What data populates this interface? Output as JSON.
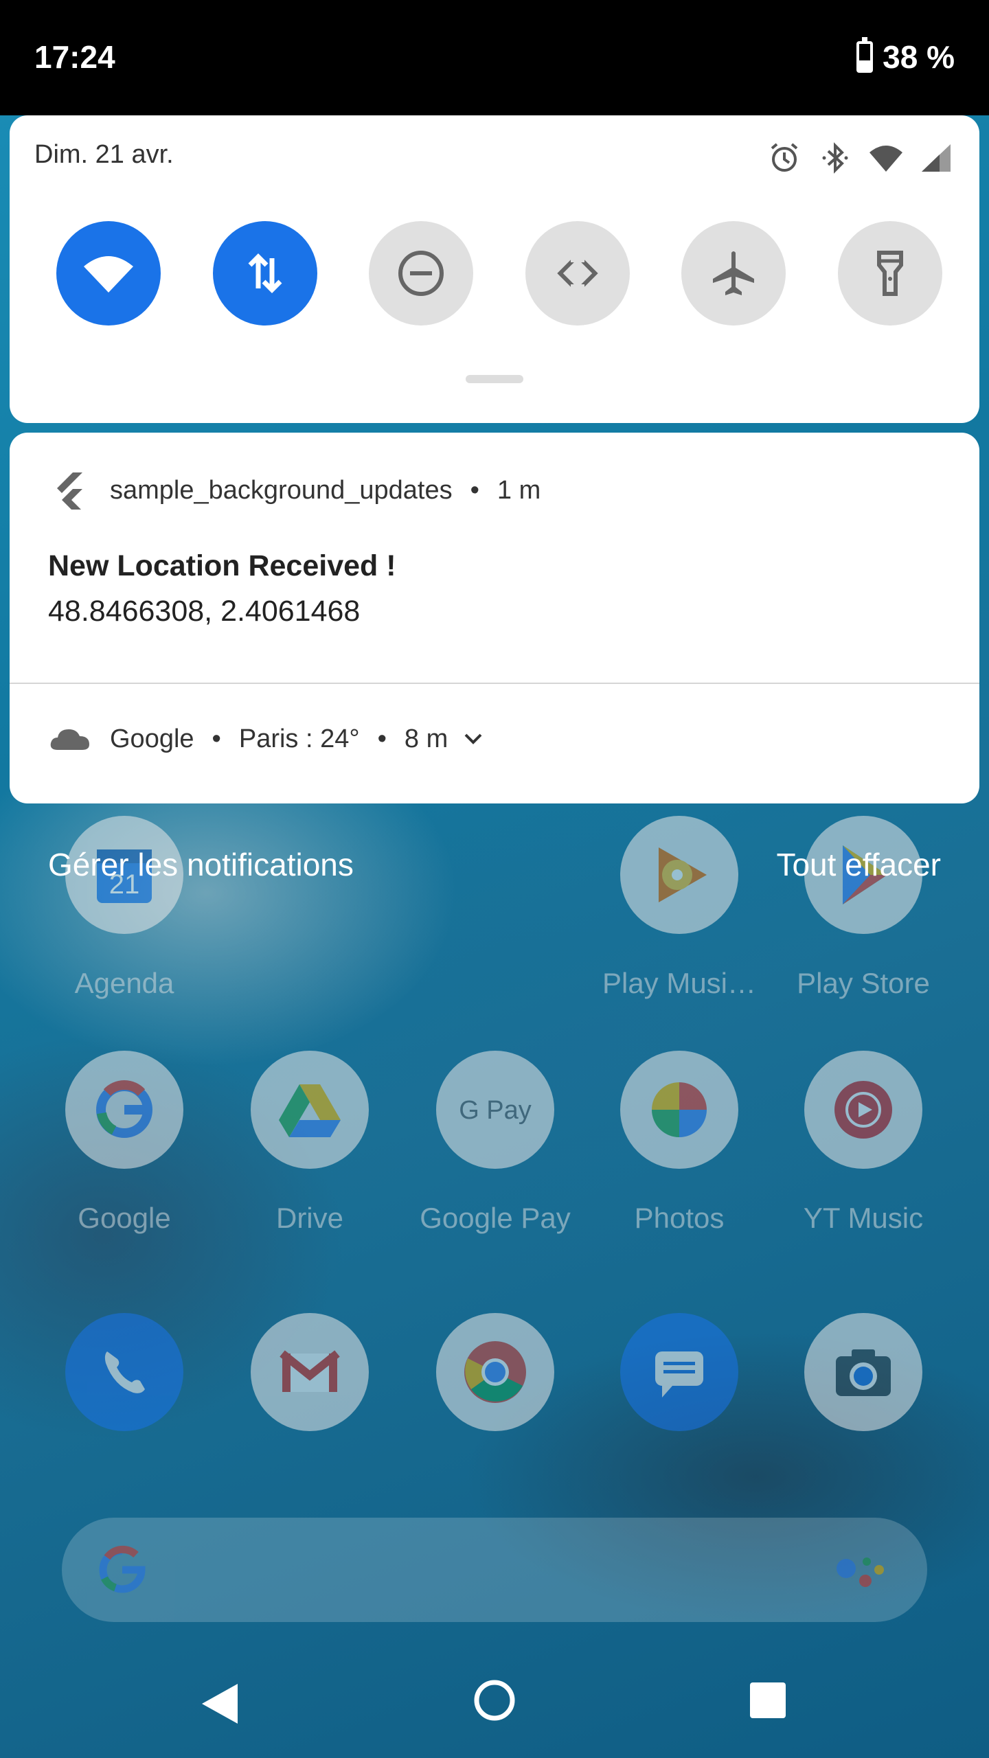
{
  "status_bar": {
    "time": "17:24",
    "battery": "38 %"
  },
  "quick_settings": {
    "date": "Dim. 21 avr.",
    "status_icons": [
      "alarm-icon",
      "bluetooth-icon",
      "wifi-icon",
      "cell-signal-icon"
    ],
    "tiles": [
      {
        "name": "wifi",
        "active": true,
        "icon": "wifi-icon"
      },
      {
        "name": "mobile-data",
        "active": true,
        "icon": "data-arrows-icon"
      },
      {
        "name": "do-not-disturb",
        "active": false,
        "icon": "do-not-disturb-icon"
      },
      {
        "name": "auto-rotate",
        "active": false,
        "icon": "rotate-icon"
      },
      {
        "name": "airplane-mode",
        "active": false,
        "icon": "airplane-icon"
      },
      {
        "name": "flashlight",
        "active": false,
        "icon": "flashlight-icon"
      }
    ]
  },
  "notifications": {
    "location": {
      "app": "sample_background_updates",
      "time": "1 m",
      "title": "New Location Received !",
      "text": "48.8466308, 2.4061468"
    },
    "weather": {
      "app": "Google",
      "detail": "Paris : 24°",
      "time": "8 m"
    }
  },
  "actions": {
    "manage": "Gérer les notifications",
    "clear_all": "Tout effacer"
  },
  "home": {
    "apps": [
      {
        "label": "Agenda",
        "icon": "calendar-icon"
      },
      {
        "label": "Play Musi…",
        "icon": "play-music-icon"
      },
      {
        "label": "Play Store",
        "icon": "play-store-icon"
      },
      {
        "label": "Google",
        "icon": "google-icon"
      },
      {
        "label": "Drive",
        "icon": "drive-icon"
      },
      {
        "label": "Google Pay",
        "icon": "google-pay-icon"
      },
      {
        "label": "Photos",
        "icon": "photos-icon"
      },
      {
        "label": "YT Music",
        "icon": "yt-music-icon"
      }
    ],
    "calendar_day": "21",
    "dock": [
      "phone-icon",
      "gmail-icon",
      "chrome-icon",
      "messages-icon",
      "camera-icon"
    ]
  },
  "colors": {
    "accent": "#1a73e8",
    "tile_inactive": "#e0e0e0"
  }
}
